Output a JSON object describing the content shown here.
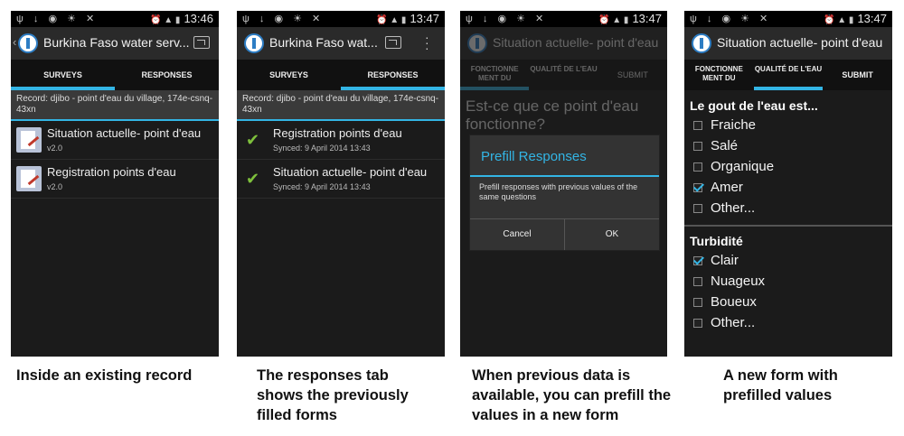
{
  "status_time_1": "13:46",
  "status_time_2": "13:47",
  "status_time_3": "13:47",
  "status_time_4": "13:47",
  "screen1": {
    "title": "Burkina Faso water serv...",
    "tabs": [
      "SURVEYS",
      "RESPONSES"
    ],
    "record": "Record: djibo - point d'eau du village, 174e-csnq-43xn",
    "items": [
      {
        "title": "Situation actuelle- point d'eau",
        "sub": "v2.0"
      },
      {
        "title": "Registration points d'eau",
        "sub": "v2.0"
      }
    ]
  },
  "screen2": {
    "title": "Burkina Faso wat...",
    "tabs": [
      "SURVEYS",
      "RESPONSES"
    ],
    "record": "Record: djibo - point d'eau du village, 174e-csnq-43xn",
    "items": [
      {
        "title": "Registration points d'eau",
        "sub": "Synced: 9 April 2014 13:43"
      },
      {
        "title": "Situation actuelle- point d'eau",
        "sub": "Synced: 9 April 2014 13:43"
      }
    ]
  },
  "screen3": {
    "title": "Situation actuelle- point d'eau",
    "tabs": [
      "FONCTIONNE MENT DU",
      "QUALITÉ DE L'EAU",
      "SUBMIT"
    ],
    "question": "Est-ce que ce point d'eau fonctionne?",
    "dialog": {
      "title": "Prefill Responses",
      "message": "Prefill responses with previous values of the same questions",
      "cancel": "Cancel",
      "ok": "OK"
    }
  },
  "screen4": {
    "title": "Situation actuelle- point d'eau",
    "tabs": [
      "FONCTIONNE MENT DU",
      "QUALITÉ DE L'EAU",
      "SUBMIT"
    ],
    "q1": "Le gout de l'eau est...",
    "q1_options": [
      {
        "label": "Fraiche",
        "checked": false
      },
      {
        "label": "Salé",
        "checked": false
      },
      {
        "label": "Organique",
        "checked": false
      },
      {
        "label": "Amer",
        "checked": true
      },
      {
        "label": "Other...",
        "checked": false
      }
    ],
    "q2": "Turbidité",
    "q2_options": [
      {
        "label": "Clair",
        "checked": true
      },
      {
        "label": "Nuageux",
        "checked": false
      },
      {
        "label": "Boueux",
        "checked": false
      },
      {
        "label": "Other...",
        "checked": false
      }
    ]
  },
  "captions": [
    "Inside an existing record",
    "The responses tab shows the previously filled forms",
    "When previous data is available, you can prefill the values in a new form",
    "A new form with prefilled values"
  ],
  "colors": {
    "accent": "#33b5e5",
    "check": "#7ec03c",
    "background": "#1b1b1b"
  }
}
